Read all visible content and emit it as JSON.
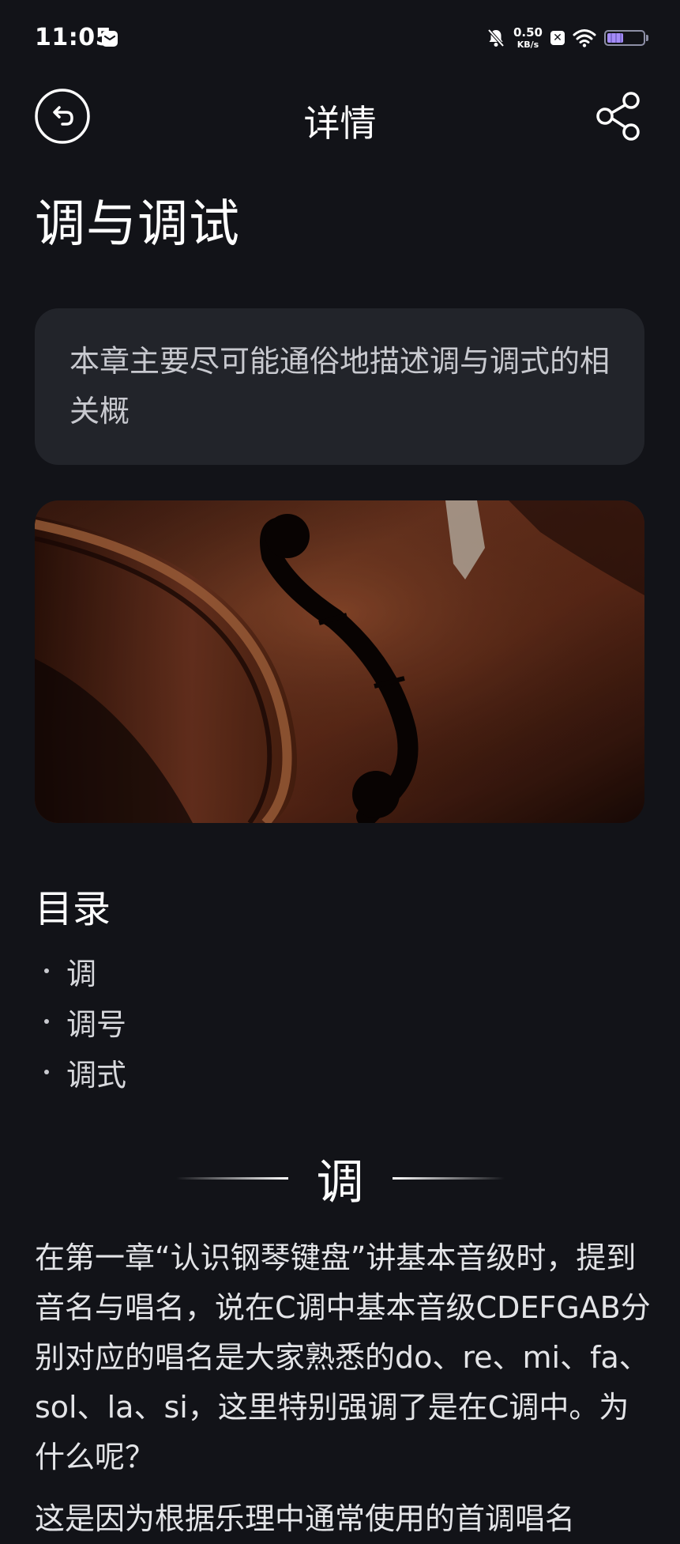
{
  "status_bar": {
    "time": "11:05",
    "net_speed_value": "0.50",
    "net_speed_unit": "KB/s",
    "battery_level": 0.45
  },
  "header": {
    "title": "详情"
  },
  "article": {
    "title": "调与调试",
    "summary": "本章主要尽可能通俗地描述调与调式的相关概",
    "toc_title": "目录",
    "toc": [
      "调",
      "调号",
      "调式"
    ],
    "section_title": "调",
    "paragraph_1": "在第一章“认识钢琴键盘”讲基本音级时，提到音名与唱名，说在C调中基本音级CDEFGAB分别对应的唱名是大家熟悉的do、re、mi、fa、sol、la、si，这里特别强调了是在C调中。为什么呢？",
    "paragraph_2_partial": "这是因为根据乐理中通常使用的首调唱名"
  },
  "colors": {
    "background": "#121318",
    "card": "#22242a",
    "text": "#ffffff",
    "muted_text": "#c8c9cf"
  },
  "icons": {
    "back": "back-arrow-icon",
    "share": "share-icon",
    "notifications_muted": "bell-off-icon",
    "wifi": "wifi-icon",
    "battery": "battery-icon",
    "message": "message-icon"
  }
}
